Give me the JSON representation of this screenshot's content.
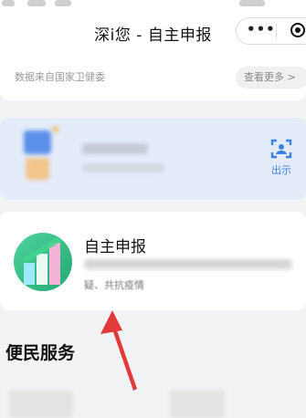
{
  "nav": {
    "title": "深i您 - 自主申报",
    "more_glyph": "•••"
  },
  "source": {
    "text": "数据来自国家卫健委",
    "more_label": "查看更多 >"
  },
  "qr_card": {
    "scan_label": "出示",
    "accent": "#3b82e6"
  },
  "report": {
    "title": "自主申报",
    "subtitle": "疑、共抗疫情"
  },
  "services": {
    "title": "便民服务"
  },
  "colors": {
    "arrow": "#e23a3a",
    "logo_green": "#3cc88a"
  }
}
